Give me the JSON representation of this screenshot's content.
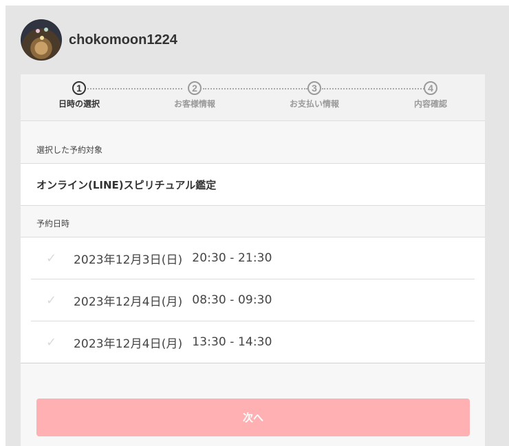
{
  "profile": {
    "username": "chokomoon1224"
  },
  "steps": [
    {
      "number": "1",
      "label": "日時の選択",
      "active": true
    },
    {
      "number": "2",
      "label": "お客様情報",
      "active": false
    },
    {
      "number": "3",
      "label": "お支払い情報",
      "active": false
    },
    {
      "number": "4",
      "label": "内容確認",
      "active": false
    }
  ],
  "selected_target": {
    "heading": "選択した予約対象",
    "value": "オンライン(LINE)スピリチュアル鑑定"
  },
  "reservation": {
    "heading": "予約日時",
    "slots": [
      {
        "date": "2023年12月3日(日)",
        "time": "20:30 - 21:30"
      },
      {
        "date": "2023年12月4日(月)",
        "time": "08:30 - 09:30"
      },
      {
        "date": "2023年12月4日(月)",
        "time": "13:30 - 14:30"
      }
    ]
  },
  "actions": {
    "next_label": "次へ"
  },
  "colors": {
    "next_button": "#ffb0b2",
    "background": "#e5e5e5"
  },
  "icons": {
    "check": "check-icon"
  }
}
